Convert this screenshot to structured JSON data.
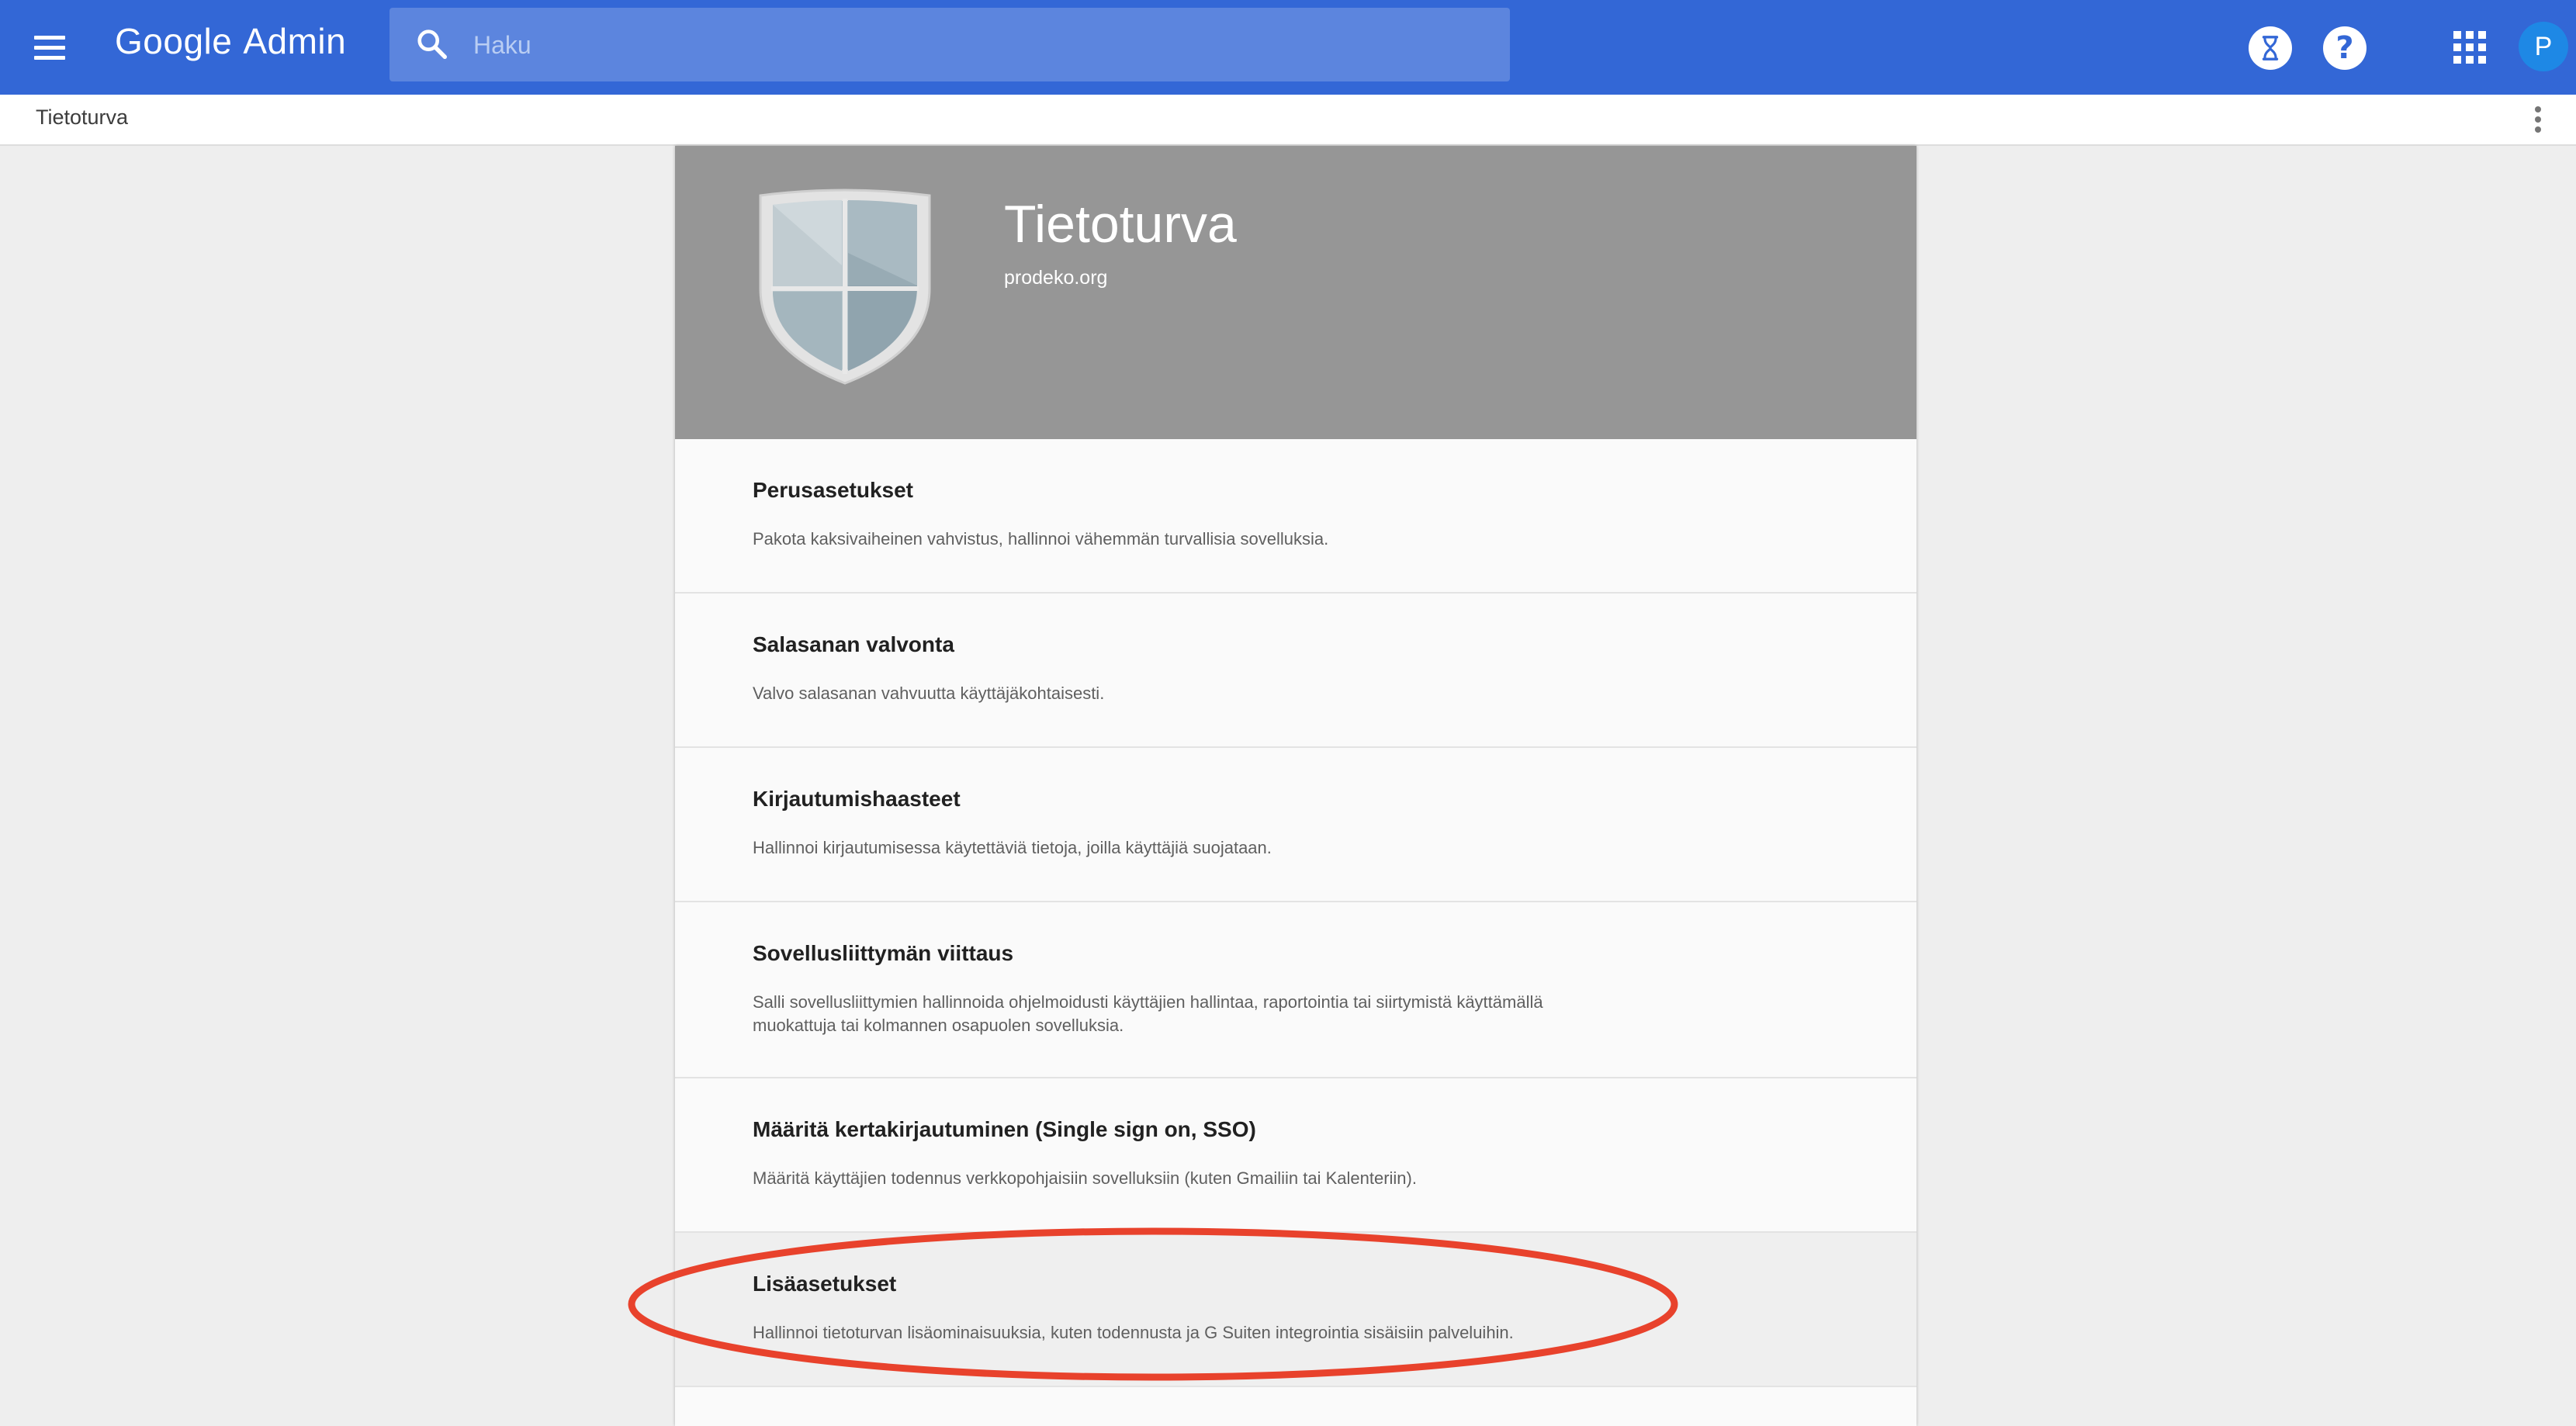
{
  "appbar": {
    "brand_google": "Google",
    "brand_admin": "Admin",
    "search_placeholder": "Haku",
    "avatar_initial": "P",
    "help_glyph": "?",
    "color": "#3367d6"
  },
  "breadcrumb": {
    "label": "Tietoturva"
  },
  "hero": {
    "title": "Tietoturva",
    "subtitle": "prodeko.org",
    "icon": "shield-icon"
  },
  "settings": [
    {
      "title": "Perusasetukset",
      "description": "Pakota kaksivaiheinen vahvistus, hallinnoi vähemmän turvallisia sovelluksia."
    },
    {
      "title": "Salasanan valvonta",
      "description": "Valvo salasanan vahvuutta käyttäjäkohtaisesti."
    },
    {
      "title": "Kirjautumishaasteet",
      "description": "Hallinnoi kirjautumisessa käytettäviä tietoja, joilla käyttäjiä suojataan."
    },
    {
      "title": "Sovellusliittymän viittaus",
      "description": "Salli sovellusliittymien hallinnoida ohjelmoidusti käyttäjien hallintaa, raportointia tai siirtymistä käyttämällä muokattuja tai kolmannen osapuolen sovelluksia."
    },
    {
      "title": "Määritä kertakirjautuminen (Single sign on, SSO)",
      "description": "Määritä käyttäjien todennus verkkopohjaisiin sovelluksiin (kuten Gmailiin tai Kalenteriin)."
    },
    {
      "title": "Lisäasetukset",
      "description": "Hallinnoi tietoturvan lisäominaisuuksia, kuten todennusta ja G Suiten integrointia sisäisiin palveluihin."
    }
  ],
  "annotation_color": "#e8422c"
}
